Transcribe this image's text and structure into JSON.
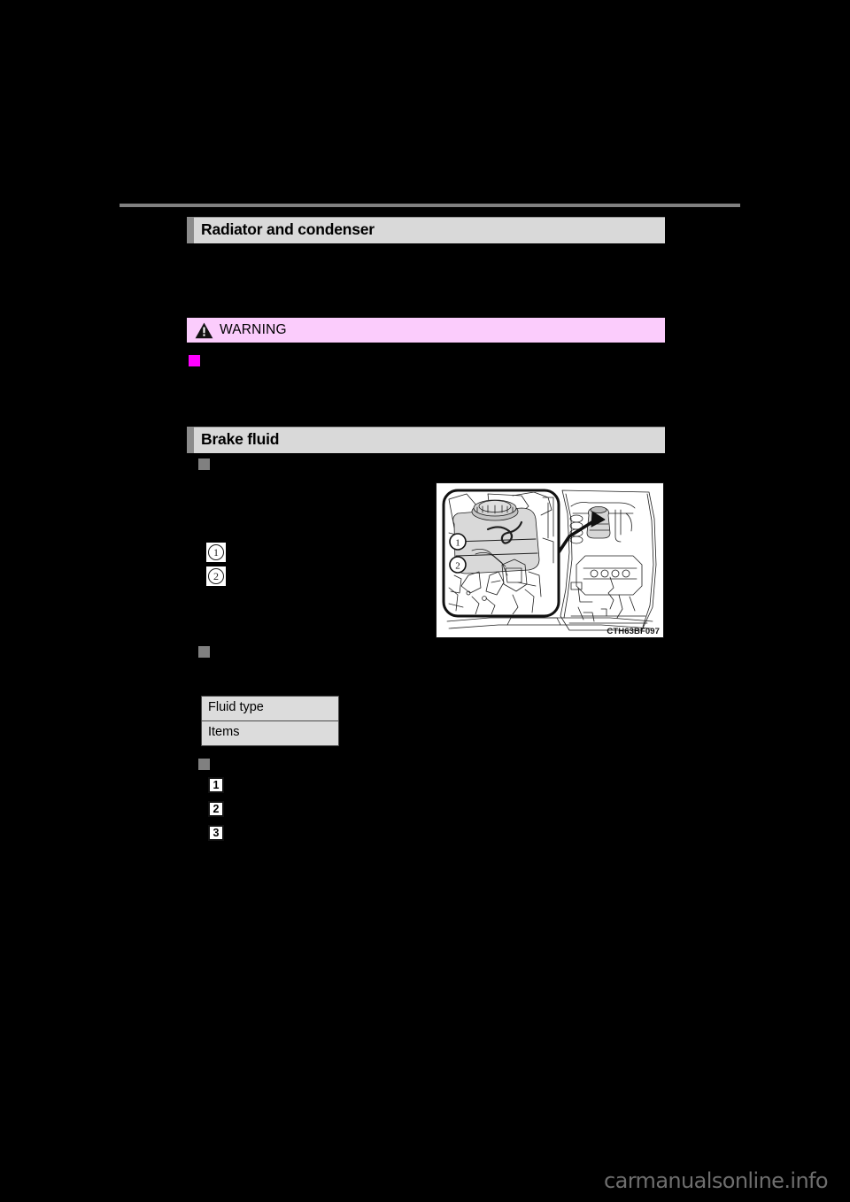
{
  "page": {
    "background_color": "#000000",
    "watermark": "carmanualsonline.info"
  },
  "top_rule": {
    "color": "#808080"
  },
  "sections": [
    {
      "id": "radiator-and-condenser",
      "title": "Radiator and condenser",
      "accent_color": "#8c8c8c",
      "background_color": "#d9d9d9"
    },
    {
      "id": "brake-fluid",
      "title": "Brake fluid",
      "accent_color": "#8c8c8c",
      "background_color": "#d9d9d9"
    }
  ],
  "warning": {
    "label": "WARNING",
    "background_color": "#fbccfc",
    "icon": "warning-triangle-icon",
    "bullet_color": "#ff00ff"
  },
  "bullets": {
    "gray_color": "#808080"
  },
  "illustration": {
    "code": "CTH63BF097",
    "alt": "brake fluid reservoir in engine compartment",
    "callouts": [
      {
        "number": "1",
        "glyph": "1"
      },
      {
        "number": "2",
        "glyph": "2"
      }
    ]
  },
  "callout_markers": [
    {
      "glyph": "1"
    },
    {
      "glyph": "2"
    }
  ],
  "spec_table": {
    "rows": [
      {
        "label": "Fluid type"
      },
      {
        "label": "Items"
      }
    ]
  },
  "steps": [
    {
      "number": "1"
    },
    {
      "number": "2"
    },
    {
      "number": "3"
    }
  ]
}
